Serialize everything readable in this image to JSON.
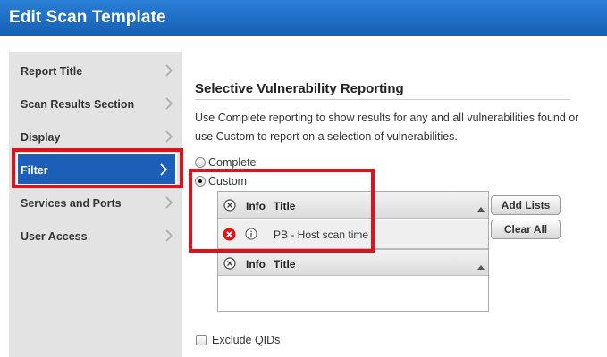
{
  "window": {
    "title": "Edit Scan Template"
  },
  "sidebar": {
    "items": [
      {
        "label": "Report Title",
        "active": false
      },
      {
        "label": "Scan Results Section",
        "active": false
      },
      {
        "label": "Display",
        "active": false
      },
      {
        "label": "Filter",
        "active": true
      },
      {
        "label": "Services and Ports",
        "active": false
      },
      {
        "label": "User Access",
        "active": false
      }
    ]
  },
  "main": {
    "section_title": "Selective Vulnerability Reporting",
    "description": "Use Complete reporting to show results for any and all vulnerabilities found or use Custom to report on a selection of vulnerabilities.",
    "reporting_options": [
      {
        "label": "Complete",
        "checked": false
      },
      {
        "label": "Custom",
        "checked": true
      }
    ],
    "selected_list": {
      "headers": {
        "info": "Info",
        "title": "Title"
      },
      "rows": [
        {
          "title": "PB - Host scan time"
        }
      ]
    },
    "available_list": {
      "headers": {
        "info": "Info",
        "title": "Title"
      }
    },
    "buttons": {
      "add_lists": "Add Lists",
      "clear_all": "Clear All"
    },
    "exclude_qids": {
      "label": "Exclude QIDs",
      "checked": false
    }
  },
  "colors": {
    "titlebar": "#1c6cc4",
    "active_item": "#1b5fb8",
    "highlight": "#e0111b",
    "remove_icon": "#e0141e"
  },
  "icons": {
    "chevron": "chevron-right-icon",
    "remove_all": "circle-x-icon",
    "remove_row": "remove-circle-icon",
    "info": "info-icon",
    "sort": "sort-up-icon"
  }
}
